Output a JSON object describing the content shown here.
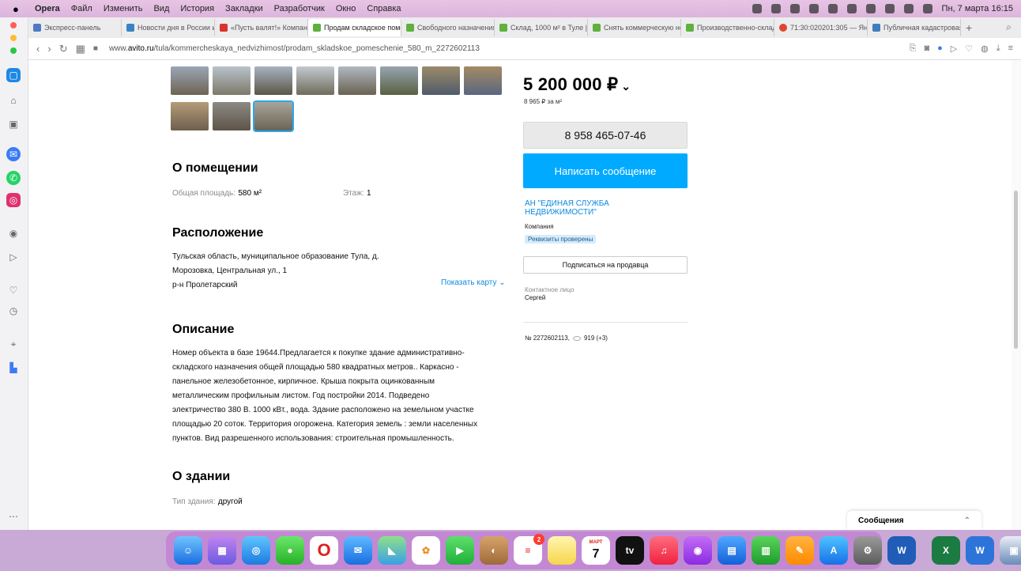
{
  "menubar": {
    "app": "Opera",
    "items": [
      "Файл",
      "Изменить",
      "Вид",
      "История",
      "Закладки",
      "Разработчик",
      "Окно",
      "Справка"
    ],
    "clock": "Пн, 7 марта 16:15"
  },
  "tabs": [
    {
      "label": "Экспресс-панель",
      "color": "#4e79c4",
      "active": false
    },
    {
      "label": "Новости дня в России и ...",
      "color": "#3b82c4",
      "active": false
    },
    {
      "label": "«Пусть валят!» Компани...",
      "color": "#d9332b",
      "active": false
    },
    {
      "label": "Продам складское помещ...",
      "color": "#5fb13d",
      "active": true
    },
    {
      "label": "Свободного назначения, ...",
      "color": "#5fb13d",
      "active": false
    },
    {
      "label": "Склад, 1000 м² в Туле | П...",
      "color": "#5fb13d",
      "active": false
    },
    {
      "label": "Снять коммерческую нед...",
      "color": "#5fb13d",
      "active": false
    },
    {
      "label": "Производственно-склад...",
      "color": "#5fb13d",
      "active": false
    },
    {
      "label": "71:30:020201:305 — Яндек...",
      "color": "#e0452f",
      "active": false
    },
    {
      "label": "Публичная кадастровая к...",
      "color": "#3d7fbd",
      "active": false
    }
  ],
  "address": {
    "prefix": "www.",
    "domain": "avito.ru",
    "path": "/tula/kommercheskaya_nedvizhimost/prodam_skladskoe_pomeschenie_580_m_2272602113"
  },
  "listing": {
    "price": "5 200 000 ₽",
    "price_per_m2": "8 965 ₽ за м²",
    "phone": "8 958 465-07-46",
    "message_button": "Написать сообщение",
    "seller_name": "АН \"ЕДИНАЯ СЛУЖБА НЕДВИЖИМОСТИ\"",
    "seller_type": "Компания",
    "verified_badge": "Реквизиты проверены",
    "subscribe_button": "Подписаться на продавца",
    "contact_label": "Контактное лицо",
    "contact_name": "Сергей",
    "ad_number": "№ 2272602113,",
    "views": "919 (+3)"
  },
  "about_room": {
    "title": "О помещении",
    "area_label": "Общая площадь:",
    "area_value": "580 м²",
    "floor_label": "Этаж:",
    "floor_value": "1"
  },
  "location": {
    "title": "Расположение",
    "address_line1": "Тульская область, муниципальное образование Тула, д.",
    "address_line2": "Морозовка, Центральная ул., 1",
    "district": "р-н Пролетарский",
    "show_map": "Показать карту"
  },
  "description": {
    "title": "Описание",
    "lines": [
      "Номер объекта в базе 19644.Предлагается к покупке здание административно-",
      "складского назначения общей площадью 580 квадратных метров.. Каркасно -",
      "панельное железобетонное, кирпичное. Крыша покрыта оцинкованным",
      "металлическим профильным листом. Год постройки 2014. Подведено",
      "электричество 380 В.  1000 кВт., вода. Здание расположено на земельном участке",
      "площадью 20 соток. Территория огорожена. Категория земель : земли населенных",
      "пунктов. Вид разрешенного использования: строительная промышленность."
    ]
  },
  "about_building": {
    "title": "О здании",
    "type_label": "Тип здания:",
    "type_value": "другой"
  },
  "messages_widget": {
    "label": "Сообщения"
  },
  "dock": {
    "calendar_month": "МАРТ",
    "calendar_day": "7",
    "tv_label": "tv",
    "reminders_badge": "2"
  }
}
